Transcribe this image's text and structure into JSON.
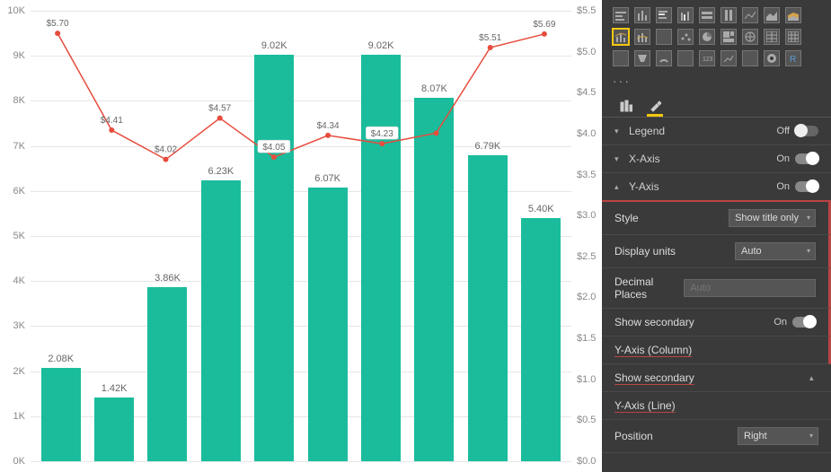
{
  "chart_data": {
    "type": "bar",
    "bars": {
      "values": [
        2.08,
        1.42,
        3.86,
        6.23,
        9.02,
        6.07,
        9.02,
        8.07,
        6.79,
        5.4
      ],
      "labels": [
        "2.08K",
        "1.42K",
        "3.86K",
        "6.23K",
        "9.02K",
        "6.07K",
        "9.02K",
        "8.07K",
        "6.79K",
        "5.40K"
      ],
      "ylim": [
        0,
        10
      ],
      "ylabel": "",
      "y_ticks": [
        "0K",
        "1K",
        "2K",
        "3K",
        "4K",
        "5K",
        "6K",
        "7K",
        "8K",
        "9K",
        "10K"
      ]
    },
    "line": {
      "values": [
        5.7,
        4.41,
        4.02,
        4.57,
        4.05,
        4.34,
        4.23,
        4.37,
        5.51,
        5.69
      ],
      "labels": [
        "$5.70",
        "$4.41",
        "$4.02",
        "$4.57",
        "$4.05",
        "$4.34",
        "$4.23",
        "",
        "$5.51",
        "$5.69"
      ],
      "boxed": [
        false,
        false,
        false,
        false,
        true,
        false,
        true,
        false,
        false,
        false
      ],
      "ylim": [
        0,
        6
      ],
      "y_ticks": [
        "$0.0",
        "$0.5",
        "$1.0",
        "$1.5",
        "$2.0",
        "$2.5",
        "$3.0",
        "$3.5",
        "$4.0",
        "$4.5",
        "$5.0",
        "$5.5"
      ]
    }
  },
  "panel": {
    "ellipsis": "···",
    "tabs": {
      "fields": "Fields",
      "format": "Format"
    },
    "legend": {
      "label": "Legend",
      "state": "Off"
    },
    "xaxis": {
      "label": "X-Axis",
      "state": "On"
    },
    "yaxis": {
      "label": "Y-Axis",
      "state": "On"
    },
    "style": {
      "label": "Style",
      "value": "Show title only"
    },
    "display_units": {
      "label": "Display units",
      "value": "Auto"
    },
    "decimals": {
      "label": "Decimal Places",
      "placeholder": "Auto"
    },
    "show_secondary": {
      "label": "Show secondary",
      "state": "On"
    },
    "yaxis_column": "Y-Axis (Column)",
    "show_secondary2": "Show secondary",
    "yaxis_line": "Y-Axis (Line)",
    "position": {
      "label": "Position",
      "value": "Right"
    }
  }
}
